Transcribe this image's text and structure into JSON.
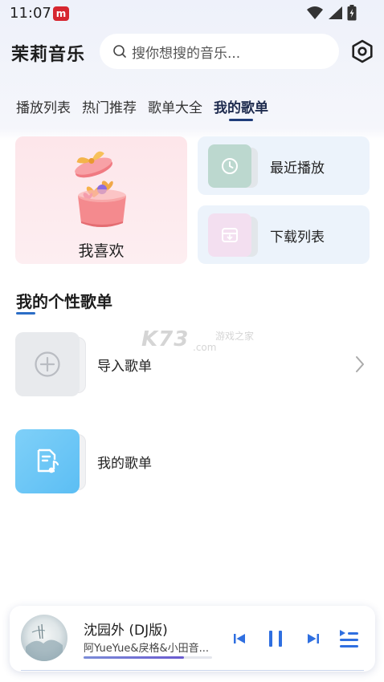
{
  "status_bar": {
    "time": "11:07",
    "app_icon_letter": "m"
  },
  "header": {
    "title": "茉莉音乐",
    "search_placeholder": "搜你想搜的音乐..."
  },
  "tabs": [
    {
      "label": "播放列表",
      "active": false
    },
    {
      "label": "热门推荐",
      "active": false
    },
    {
      "label": "歌单大全",
      "active": false
    },
    {
      "label": "我的歌单",
      "active": true
    }
  ],
  "cards": {
    "favorites": "我喜欢",
    "recent": "最近播放",
    "downloads": "下载列表"
  },
  "section": {
    "title": "我的个性歌单"
  },
  "playlists": [
    {
      "label": "导入歌单",
      "icon": "plus-circle-icon"
    },
    {
      "label": "我的歌单",
      "icon": "music-doc-icon"
    }
  ],
  "watermark": {
    "logo": "K73",
    "text": "游戏之家",
    "domain": ".com"
  },
  "player": {
    "title": "沈园外 (DJ版)",
    "artist": "阿YueYue&戾格&小田音...",
    "progress": 0.78
  },
  "colors": {
    "accent": "#2b6dc6",
    "player_blue": "#2f6fe0"
  }
}
